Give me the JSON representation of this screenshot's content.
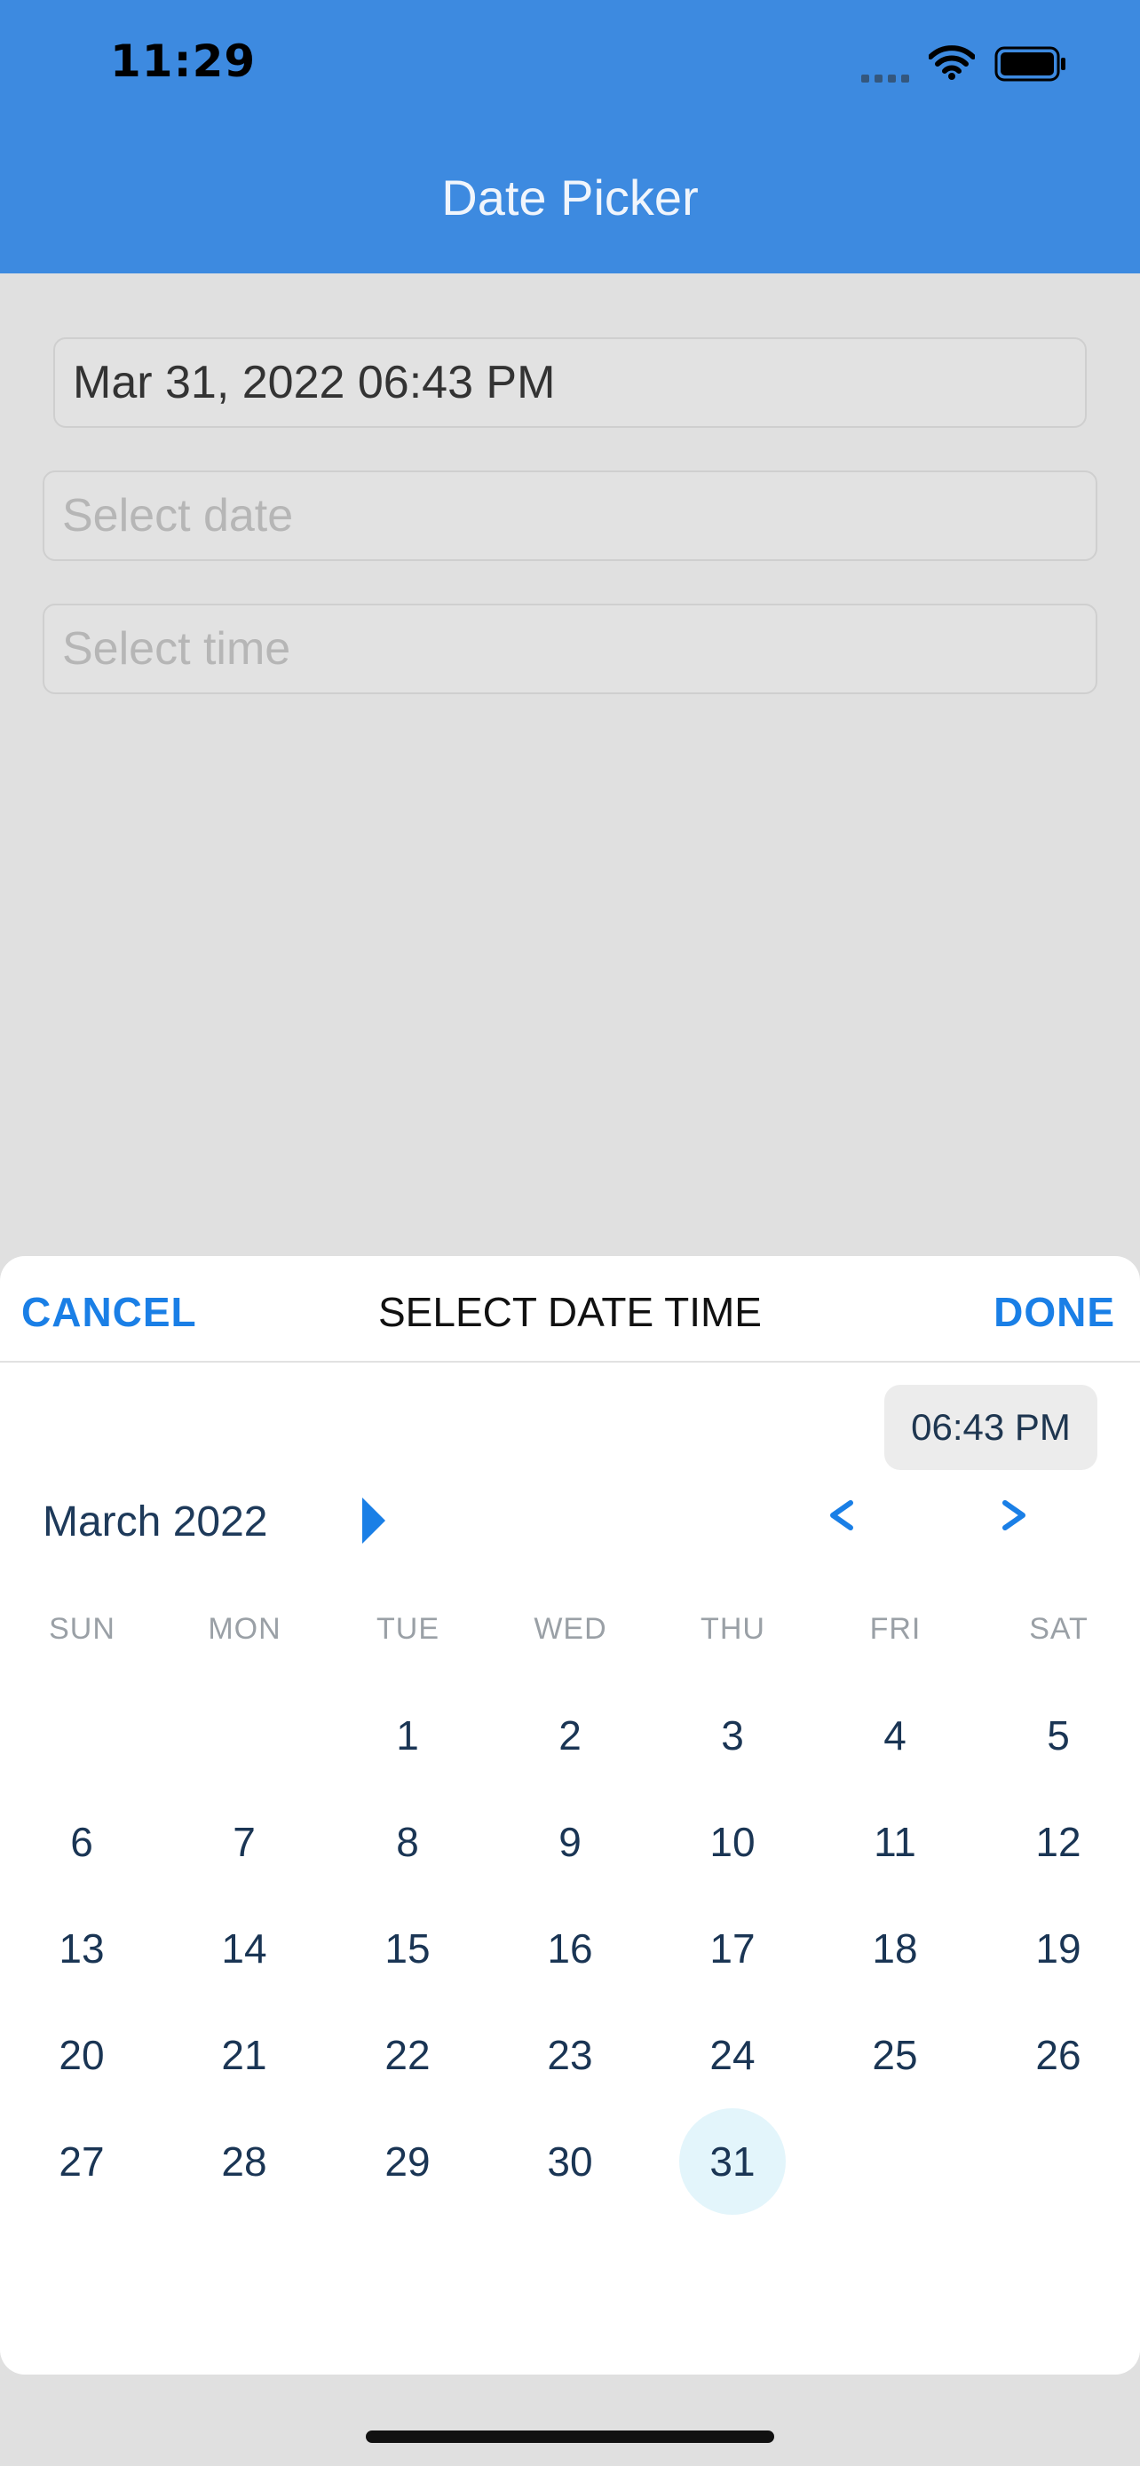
{
  "status_bar": {
    "time": "11:29"
  },
  "nav": {
    "title": "Date Picker"
  },
  "fields": {
    "datetime_value": "Mar 31, 2022 06:43 PM",
    "date_placeholder": "Select date",
    "time_placeholder": "Select time"
  },
  "sheet": {
    "cancel_label": "CANCEL",
    "title": "SELECT DATE TIME",
    "done_label": "DONE",
    "time_chip": "06:43 PM",
    "month_label": "March 2022",
    "weekdays": [
      "SUN",
      "MON",
      "TUE",
      "WED",
      "THU",
      "FRI",
      "SAT"
    ],
    "days": [
      "1",
      "2",
      "3",
      "4",
      "5",
      "6",
      "7",
      "8",
      "9",
      "10",
      "11",
      "12",
      "13",
      "14",
      "15",
      "16",
      "17",
      "18",
      "19",
      "20",
      "21",
      "22",
      "23",
      "24",
      "25",
      "26",
      "27",
      "28",
      "29",
      "30",
      "31"
    ],
    "selected_day": "31",
    "first_weekday_index": 2
  },
  "colors": {
    "header": "#3d8ae0",
    "accent": "#1a7fe6",
    "selected_day_bg": "#e3f5fb"
  },
  "icons": [
    "cellular-signal-icon",
    "wifi-icon",
    "battery-icon",
    "month-expand-icon",
    "chevron-left-icon",
    "chevron-right-icon"
  ]
}
